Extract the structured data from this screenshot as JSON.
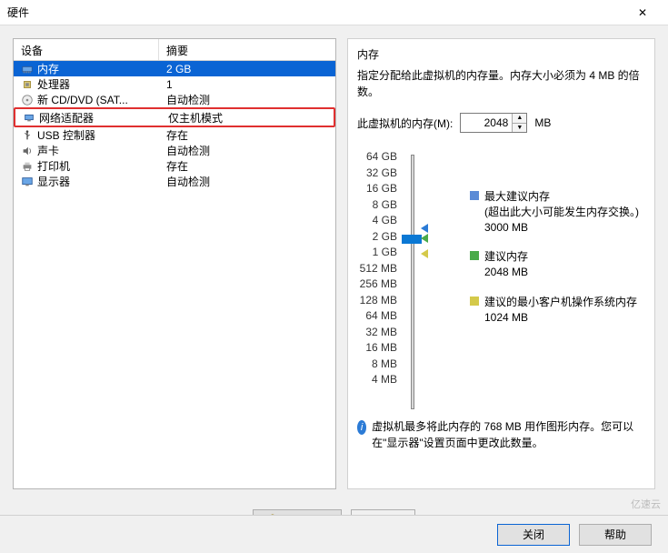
{
  "window": {
    "title": "硬件",
    "close_x": "✕"
  },
  "columns": {
    "device": "设备",
    "summary": "摘要"
  },
  "devices": [
    {
      "icon": "memory-icon",
      "name": "内存",
      "summary": "2 GB",
      "selected": true
    },
    {
      "icon": "cpu-icon",
      "name": "处理器",
      "summary": "1"
    },
    {
      "icon": "cd-icon",
      "name": "新 CD/DVD (SAT...",
      "summary": "自动检测"
    },
    {
      "icon": "network-icon",
      "name": "网络适配器",
      "summary": "仅主机模式",
      "highlighted": true
    },
    {
      "icon": "usb-icon",
      "name": "USB 控制器",
      "summary": "存在"
    },
    {
      "icon": "sound-icon",
      "name": "声卡",
      "summary": "自动检测"
    },
    {
      "icon": "printer-icon",
      "name": "打印机",
      "summary": "存在"
    },
    {
      "icon": "display-icon",
      "name": "显示器",
      "summary": "自动检测"
    }
  ],
  "memory_panel": {
    "title": "内存",
    "desc": "指定分配给此虚拟机的内存量。内存大小必须为 4 MB 的倍数。",
    "field_label": "此虚拟机的内存(M):",
    "value": "2048",
    "unit": "MB",
    "ticks": [
      "64 GB",
      "32 GB",
      "16 GB",
      "8 GB",
      "4 GB",
      "2 GB",
      "1 GB",
      "512 MB",
      "256 MB",
      "128 MB",
      "64 MB",
      "32 MB",
      "16 MB",
      "8 MB",
      "4 MB"
    ],
    "legend": {
      "max": {
        "label": "最大建议内存",
        "note": "(超出此大小可能发生内存交换。)",
        "value": "3000 MB"
      },
      "rec": {
        "label": "建议内存",
        "value": "2048 MB"
      },
      "min": {
        "label": "建议的最小客户机操作系统内存",
        "value": "1024 MB"
      }
    },
    "info": "虚拟机最多将此内存的 768 MB 用作图形内存。您可以在\"显示器\"设置页面中更改此数量。"
  },
  "buttons": {
    "add": "添加(A)...",
    "remove": "移除(R)",
    "close": "关闭",
    "help": "帮助"
  },
  "watermark": "亿速云"
}
